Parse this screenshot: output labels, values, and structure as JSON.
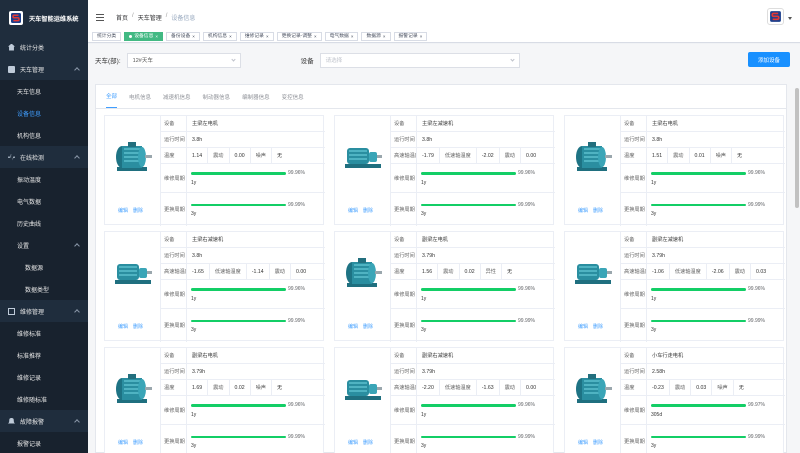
{
  "app": {
    "title": "天车智能运维系统"
  },
  "sidebar": {
    "items": [
      {
        "label": "统计分类",
        "level": 0,
        "icon": "house-icon"
      },
      {
        "label": "天车管理",
        "level": 0,
        "icon": "truck-icon",
        "open": true
      },
      {
        "label": "天车信息",
        "level": 1
      },
      {
        "label": "设备信息",
        "level": 1,
        "active": true
      },
      {
        "label": "机构信息",
        "level": 1
      },
      {
        "label": "在线检测",
        "level": 0,
        "icon": "pulse-icon",
        "open": true
      },
      {
        "label": "振动温度",
        "level": 1
      },
      {
        "label": "电气数据",
        "level": 1
      },
      {
        "label": "历史曲线",
        "level": 1
      },
      {
        "label": "设置",
        "level": 1,
        "open": true
      },
      {
        "label": "数据源",
        "level": 2
      },
      {
        "label": "数据类型",
        "level": 2
      },
      {
        "label": "维修管理",
        "level": 0,
        "icon": "grid-icon",
        "open": true
      },
      {
        "label": "维修标准",
        "level": 1
      },
      {
        "label": "标准推荐",
        "level": 1
      },
      {
        "label": "维修记录",
        "level": 1
      },
      {
        "label": "维修随标准",
        "level": 1
      },
      {
        "label": "故障报警",
        "level": 0,
        "icon": "bell-icon",
        "open": true
      },
      {
        "label": "报警记录",
        "level": 1
      }
    ]
  },
  "breadcrumb": {
    "home": "首页",
    "section": "天车管理",
    "current": "设备信息"
  },
  "tags": [
    {
      "label": "统计分类",
      "active": false
    },
    {
      "label": "设备信息",
      "active": true
    },
    {
      "label": "备份设备",
      "active": false
    },
    {
      "label": "机构信息",
      "active": false
    },
    {
      "label": "维修记录",
      "active": false
    },
    {
      "label": "更换记录-调整",
      "active": false
    },
    {
      "label": "电气数据",
      "active": false
    },
    {
      "label": "数据源",
      "active": false
    },
    {
      "label": "报警记录",
      "active": false
    }
  ],
  "filters": {
    "crane_label": "天车(部):",
    "crane_value": "12#天车",
    "device_label": "设备",
    "device_placeholder": "请选择",
    "add_button": "添加设备"
  },
  "tabs": [
    "全部",
    "电机信息",
    "减速机信息",
    "制动器信息",
    "编制器信息",
    "变控信息"
  ],
  "card_labels": {
    "device": "设备",
    "runtime": "运行时间",
    "temp": "温度",
    "vib": "震动",
    "noise": "噪声",
    "maint": "维修周期",
    "replace": "更换周期",
    "edit": "编辑",
    "delete": "删除"
  },
  "cards": [
    {
      "name": "主梁左电机",
      "runtime": "3.8h",
      "temp_label": "温度",
      "temp": "1.14",
      "vib": "0.00",
      "noise": "无",
      "kind": "motor",
      "maint_pct": 99.96,
      "maint_text": "99.96%",
      "maint_period": "1y",
      "rep_pct": 99.99,
      "rep_text": "99.99%",
      "rep_period": "3y"
    },
    {
      "name": "主梁左减速机",
      "runtime": "3.8h",
      "temp_label": "高速轴温度",
      "temp": "-1.79",
      "temp2_label": "低速轴温度",
      "temp2": "-2.02",
      "vib": "0.00",
      "kind": "reducer",
      "maint_pct": 99.96,
      "maint_text": "99.96%",
      "maint_period": "1y",
      "rep_pct": 99.99,
      "rep_text": "99.99%",
      "rep_period": "3y"
    },
    {
      "name": "主梁右电机",
      "runtime": "3.8h",
      "temp_label": "温度",
      "temp": "1.51",
      "vib": "0.01",
      "noise": "无",
      "kind": "motor",
      "maint_pct": 99.96,
      "maint_text": "99.96%",
      "maint_period": "1y",
      "rep_pct": 99.99,
      "rep_text": "99.99%",
      "rep_period": "3y"
    },
    {
      "name": "主梁右减速机",
      "runtime": "3.8h",
      "temp_label": "高速轴温度",
      "temp": "-1.65",
      "temp2_label": "低速轴温度",
      "temp2": "-1.14",
      "vib": "0.00",
      "kind": "reducer",
      "maint_pct": 99.96,
      "maint_text": "99.96%",
      "maint_period": "1y",
      "rep_pct": 99.99,
      "rep_text": "99.99%",
      "rep_period": "3y"
    },
    {
      "name": "副梁左电机",
      "runtime": "3.79h",
      "temp_label": "温度",
      "temp": "1.56",
      "vib": "0.02",
      "noise": "无",
      "noise_label": "异性",
      "kind": "motor",
      "maint_pct": 99.96,
      "maint_text": "99.96%",
      "maint_period": "1y",
      "rep_pct": 99.99,
      "rep_text": "99.99%",
      "rep_period": "3y"
    },
    {
      "name": "副梁左减速机",
      "runtime": "3.79h",
      "temp_label": "高速轴温度",
      "temp": "-1.06",
      "temp2_label": "低速轴温度",
      "temp2": "-2.06",
      "vib": "0.03",
      "kind": "reducer",
      "maint_pct": 99.96,
      "maint_text": "99.96%",
      "maint_period": "1y",
      "rep_pct": 99.99,
      "rep_text": "99.99%",
      "rep_period": "3y"
    },
    {
      "name": "副梁右电机",
      "runtime": "3.79h",
      "temp_label": "温度",
      "temp": "1.69",
      "vib": "0.02",
      "noise": "无",
      "kind": "motor",
      "maint_pct": 99.96,
      "maint_text": "99.96%",
      "maint_period": "1y",
      "rep_pct": 99.99,
      "rep_text": "99.99%",
      "rep_period": "3y"
    },
    {
      "name": "副梁右减速机",
      "runtime": "3.79h",
      "temp_label": "高速轴温度",
      "temp": "-2.20",
      "temp2_label": "低速轴温度",
      "temp2": "-1.63",
      "vib": "0.00",
      "kind": "reducer",
      "maint_pct": 99.96,
      "maint_text": "99.96%",
      "maint_period": "1y",
      "rep_pct": 99.99,
      "rep_text": "99.99%",
      "rep_period": "3y"
    },
    {
      "name": "小车行走电机",
      "runtime": "2.58h",
      "temp_label": "温度",
      "temp": "-0.23",
      "vib": "0.03",
      "noise": "无",
      "kind": "motor",
      "maint_pct": 99.97,
      "maint_text": "99.97%",
      "maint_period": "305d",
      "rep_pct": 99.99,
      "rep_text": "99.99%",
      "rep_period": "3y"
    }
  ],
  "colors": {
    "sidebar_bg": "#1f2d3d",
    "active_link": "#409eff",
    "tag_active": "#42b983",
    "progress": "#13ce66",
    "primary_button": "#1890ff"
  }
}
